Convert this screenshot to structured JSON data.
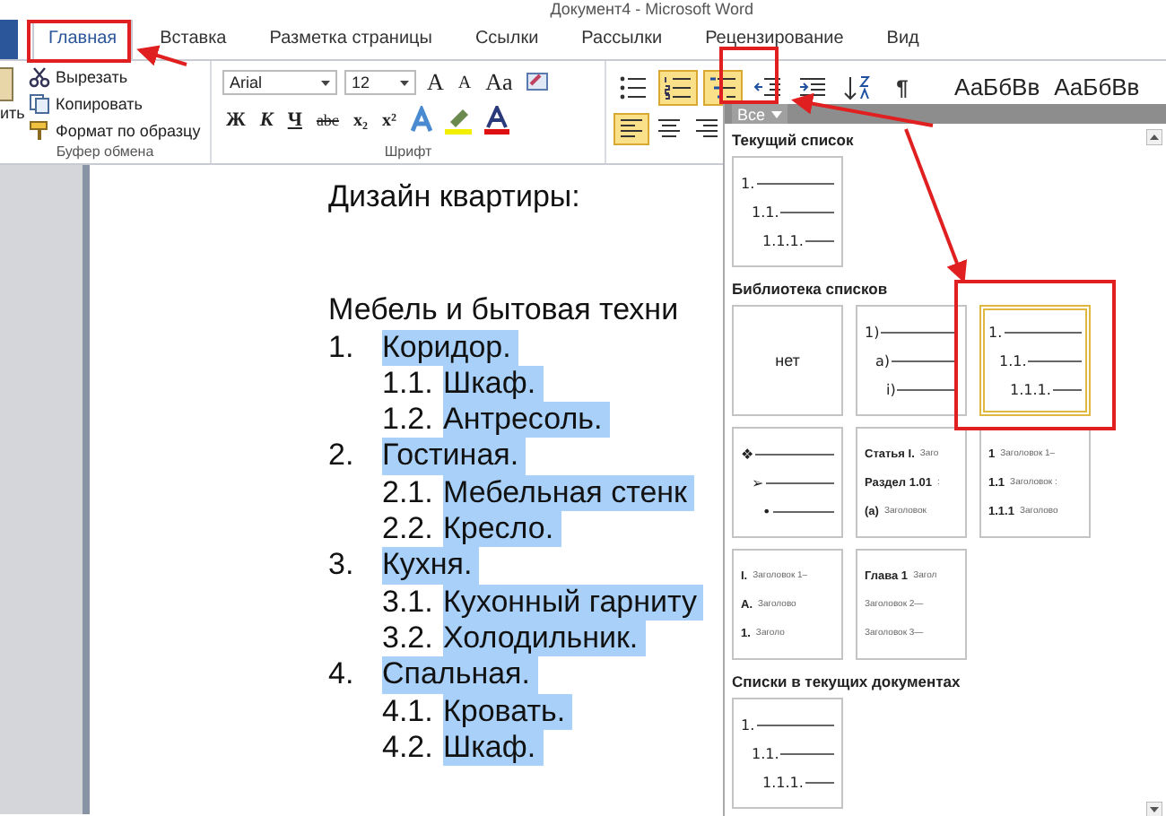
{
  "window": {
    "title": "Документ4 - Microsoft Word"
  },
  "tabs": [
    {
      "label": "Главная",
      "selected": true
    },
    {
      "label": "Вставка",
      "selected": false
    },
    {
      "label": "Разметка страницы",
      "selected": false
    },
    {
      "label": "Ссылки",
      "selected": false
    },
    {
      "label": "Рассылки",
      "selected": false
    },
    {
      "label": "Рецензирование",
      "selected": false
    },
    {
      "label": "Вид",
      "selected": false
    }
  ],
  "ribbon": {
    "clipboard": {
      "paste_label": "ить",
      "actions": [
        {
          "kind": "cut",
          "label": "Вырезать"
        },
        {
          "kind": "copy",
          "label": "Копировать"
        },
        {
          "kind": "painter",
          "label": "Формат по образцу"
        }
      ],
      "group_label": "Буфер обмена"
    },
    "font": {
      "font_name": "Arial",
      "font_size": "12",
      "size_buttons": [
        {
          "kind": "grow",
          "label": "A"
        },
        {
          "kind": "shrink",
          "label": "A"
        },
        {
          "kind": "case",
          "label": "Aa"
        }
      ],
      "format_buttons": [
        {
          "kind": "bold",
          "label": "Ж"
        },
        {
          "kind": "italic",
          "label": "К"
        },
        {
          "kind": "underline",
          "label": "Ч"
        },
        {
          "kind": "strike",
          "label": "abc"
        },
        {
          "kind": "sub",
          "label": "x₂"
        },
        {
          "kind": "sup",
          "label": "x²"
        }
      ],
      "group_label": "Шрифт"
    },
    "paragraph": {
      "buttons": [
        {
          "kind": "bullets",
          "on": false
        },
        {
          "kind": "numbering",
          "on": true
        },
        {
          "kind": "multilevel",
          "on": true
        },
        {
          "kind": "outdent",
          "on": false
        },
        {
          "kind": "indent",
          "on": false
        },
        {
          "kind": "sort",
          "on": false
        },
        {
          "kind": "marks",
          "on": false,
          "glyph": "¶"
        }
      ],
      "align": [
        {
          "kind": "left",
          "on": true
        },
        {
          "kind": "center",
          "on": false
        },
        {
          "kind": "right",
          "on": false
        }
      ]
    },
    "styles": [
      "АаБбВв",
      "АаБбВв"
    ]
  },
  "document": {
    "title": "Дизайн квартиры:",
    "heading": "Мебель и бытовая техни",
    "list": [
      {
        "num": "1.",
        "text": "Коридор.",
        "selected": true,
        "children": [
          {
            "num": "1.1.",
            "text": "Шкаф.",
            "selected": true
          },
          {
            "num": "1.2.",
            "text": "Антресоль.",
            "selected": true
          }
        ]
      },
      {
        "num": "2.",
        "text": "Гостиная.",
        "selected": true,
        "children": [
          {
            "num": "2.1.",
            "text": "Мебельная стенк",
            "selected": true
          },
          {
            "num": "2.2.",
            "text": "Кресло.",
            "selected": true
          }
        ]
      },
      {
        "num": "3.",
        "text": "Кухня.",
        "selected": true,
        "children": [
          {
            "num": "3.1.",
            "text": "Кухонный гарниту",
            "selected": true
          },
          {
            "num": "3.2.",
            "text": "Холодильник.",
            "selected": true
          }
        ]
      },
      {
        "num": "4.",
        "text": "Спальная.",
        "selected": true,
        "children": [
          {
            "num": "4.1.",
            "text": "Кровать.",
            "selected": true
          },
          {
            "num": "4.2.",
            "text": "Шкаф.",
            "selected": true
          }
        ]
      }
    ]
  },
  "dropdown": {
    "filter": "Все",
    "sections": [
      {
        "title": "Текущий список",
        "tiles": [
          {
            "kind": "levels",
            "selected": false,
            "lines": [
              {
                "num": "1."
              },
              {
                "num": "1.1."
              },
              {
                "num": "1.1.1."
              }
            ]
          }
        ]
      },
      {
        "title": "Библиотека списков",
        "tiles": [
          {
            "kind": "none",
            "selected": false,
            "label": "нет"
          },
          {
            "kind": "levels",
            "selected": false,
            "lines": [
              {
                "num": "1)"
              },
              {
                "num": "a)"
              },
              {
                "num": "i)"
              }
            ]
          },
          {
            "kind": "levels",
            "selected": true,
            "lines": [
              {
                "num": "1."
              },
              {
                "num": "1.1."
              },
              {
                "num": "1.1.1."
              }
            ]
          },
          {
            "kind": "levels",
            "selected": false,
            "lines": [
              {
                "num": "❖"
              },
              {
                "num": "➢"
              },
              {
                "num": "•"
              }
            ]
          },
          {
            "kind": "headings",
            "selected": false,
            "lines": [
              {
                "num": "Статья I.",
                "text": "Заго"
              },
              {
                "num": "Раздел 1.01",
                "text": ":"
              },
              {
                "num": "(a)",
                "text": "Заголовок"
              }
            ]
          },
          {
            "kind": "headings",
            "selected": false,
            "lines": [
              {
                "num": "1",
                "text": "Заголовок 1–"
              },
              {
                "num": "1.1",
                "text": "Заголовок :"
              },
              {
                "num": "1.1.1",
                "text": "Заголово"
              }
            ]
          },
          {
            "kind": "headings",
            "selected": false,
            "lines": [
              {
                "num": "I.",
                "text": "Заголовок 1–"
              },
              {
                "num": "A.",
                "text": "Заголово"
              },
              {
                "num": "1.",
                "text": "Заголо"
              }
            ]
          },
          {
            "kind": "headings",
            "selected": false,
            "lines": [
              {
                "num": "Глава 1",
                "text": "Загол"
              },
              {
                "text": "Заголовок 2—"
              },
              {
                "text": "Заголовок 3—"
              }
            ]
          }
        ]
      },
      {
        "title": "Списки в текущих документах",
        "tiles": [
          {
            "kind": "levels",
            "selected": false,
            "lines": [
              {
                "num": "1."
              },
              {
                "num": "1.1."
              },
              {
                "num": "1.1.1."
              }
            ]
          }
        ]
      }
    ]
  }
}
